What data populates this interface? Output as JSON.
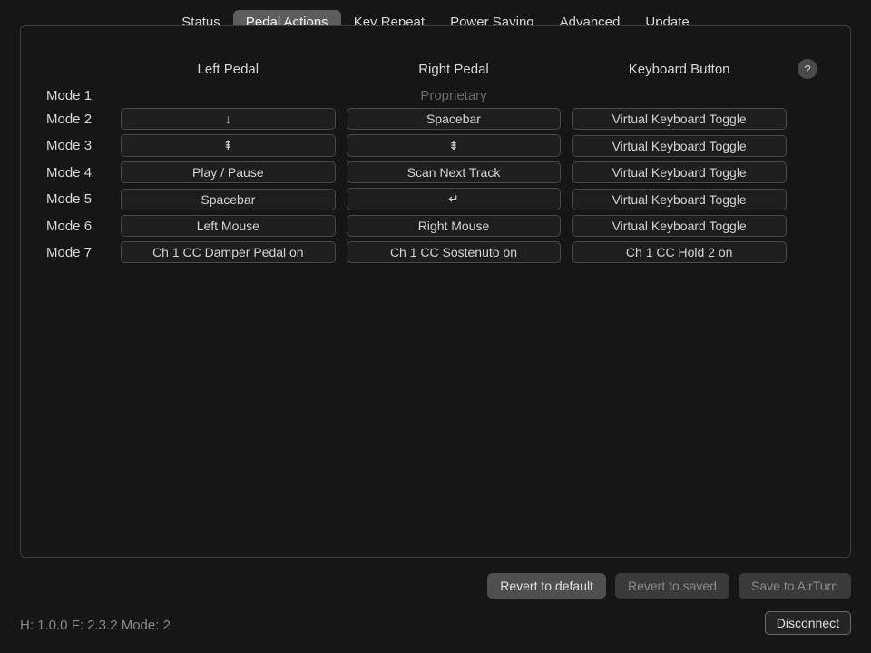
{
  "tabs": {
    "status": "Status",
    "pedal_actions": "Pedal Actions",
    "key_repeat": "Key Repeat",
    "power_saving": "Power Saving",
    "advanced": "Advanced",
    "update": "Update"
  },
  "columns": {
    "left": "Left Pedal",
    "right": "Right Pedal",
    "keyboard": "Keyboard Button"
  },
  "help": "?",
  "rows": {
    "mode1": {
      "label": "Mode 1",
      "proprietary": "Proprietary"
    },
    "mode2": {
      "label": "Mode 2",
      "left": "↓",
      "right": "Spacebar",
      "keyboard": "Virtual Keyboard Toggle"
    },
    "mode3": {
      "label": "Mode 3",
      "left": "⇞",
      "right": "⇟",
      "keyboard": "Virtual Keyboard Toggle"
    },
    "mode4": {
      "label": "Mode 4",
      "left": "Play / Pause",
      "right": "Scan Next Track",
      "keyboard": "Virtual Keyboard Toggle"
    },
    "mode5": {
      "label": "Mode 5",
      "left": "Spacebar",
      "right": "↵",
      "keyboard": "Virtual Keyboard Toggle"
    },
    "mode6": {
      "label": "Mode 6",
      "left": "Left Mouse",
      "right": "Right Mouse",
      "keyboard": "Virtual Keyboard Toggle"
    },
    "mode7": {
      "label": "Mode 7",
      "left": "Ch 1 CC Damper Pedal on",
      "right": "Ch 1 CC Sostenuto on",
      "keyboard": "Ch 1 CC Hold 2 on"
    }
  },
  "footer": {
    "revert_default": "Revert to default",
    "revert_saved": "Revert to saved",
    "save": "Save to AirTurn"
  },
  "status": "H: 1.0.0  F: 2.3.2  Mode: 2",
  "disconnect": "Disconnect"
}
